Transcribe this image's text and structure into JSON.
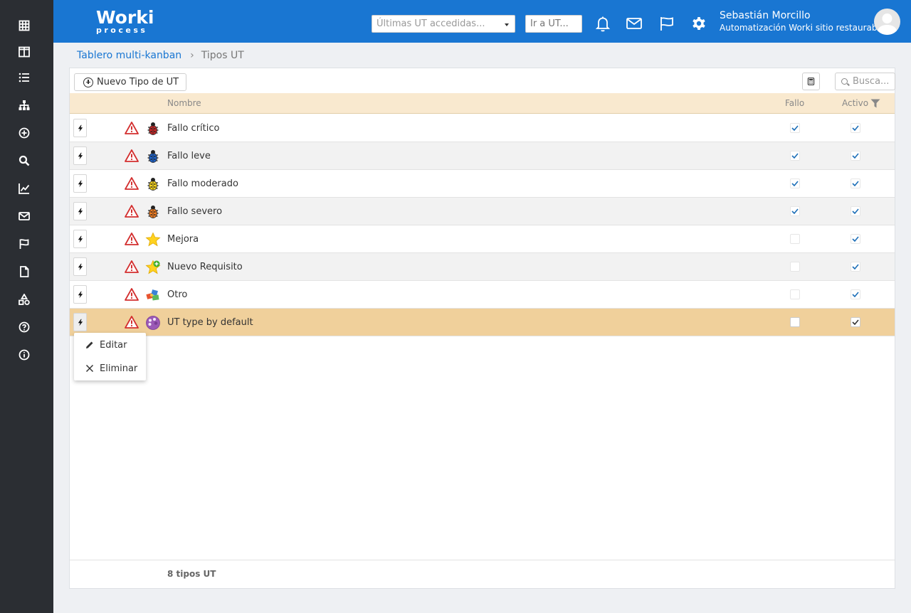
{
  "header": {
    "logo_main": "Worki",
    "logo_sub": "process",
    "recent_placeholder": "Últimas UT accedidas...",
    "goto_placeholder": "Ir a UT...",
    "user_name": "Sebastián Morcillo",
    "user_org": "Automatización Worki sitio restaurable",
    "colors": {
      "bar": "#1976d2"
    }
  },
  "sidebar": {
    "icons": [
      "grid-icon",
      "columns-icon",
      "list-icon",
      "hierarchy-icon",
      "add-circle-icon",
      "search-icon",
      "chart-line-icon",
      "mail-icon",
      "flag-icon",
      "document-icon",
      "shapes-icon",
      "help-icon",
      "info-icon"
    ]
  },
  "breadcrumb": {
    "parent": "Tablero multi-kanban",
    "current": "Tipos UT"
  },
  "toolbar": {
    "new_label": "Nuevo Tipo de UT",
    "search_placeholder": "Busca..."
  },
  "table": {
    "columns": {
      "name": "Nombre",
      "fallo": "Fallo",
      "activo": "Activo"
    },
    "rows": [
      {
        "name": "Fallo crítico",
        "icon": "red-bug-icon",
        "fallo": true,
        "activo": true
      },
      {
        "name": "Fallo leve",
        "icon": "blue-bug-icon",
        "fallo": true,
        "activo": true
      },
      {
        "name": "Fallo moderado",
        "icon": "yellow-bug-icon",
        "fallo": true,
        "activo": true
      },
      {
        "name": "Fallo severo",
        "icon": "orange-bug-icon",
        "fallo": true,
        "activo": true
      },
      {
        "name": "Mejora",
        "icon": "star-icon",
        "fallo": false,
        "activo": true
      },
      {
        "name": "Nuevo Requisito",
        "icon": "star-plus-icon",
        "fallo": false,
        "activo": true
      },
      {
        "name": "Otro",
        "icon": "puzzle-icon",
        "fallo": false,
        "activo": true
      },
      {
        "name": "UT type by default",
        "icon": "palette-icon",
        "fallo": false,
        "activo": true,
        "selected": true
      }
    ],
    "footer": "8 tipos UT"
  },
  "context_menu": {
    "edit": "Editar",
    "delete": "Eliminar"
  }
}
